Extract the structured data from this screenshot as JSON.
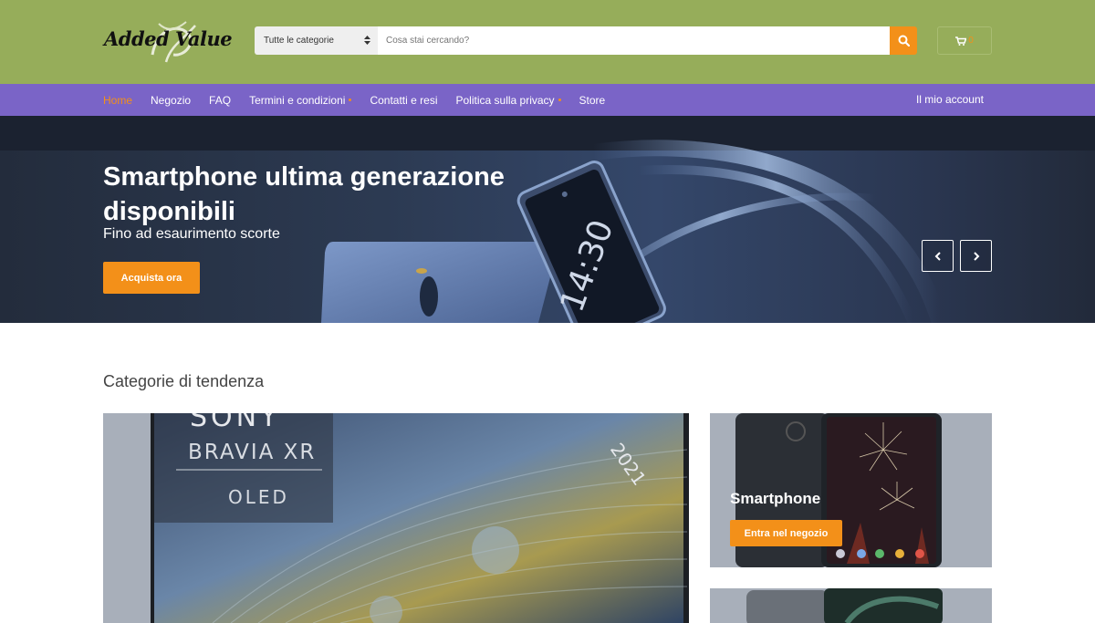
{
  "brand": {
    "logo_text": "Added Value"
  },
  "search": {
    "category": "Tutte le categorie",
    "placeholder": "Cosa stai cercando?"
  },
  "cart": {
    "count": "0"
  },
  "nav": {
    "items": [
      {
        "label": "Home",
        "active": true,
        "dropdown": false
      },
      {
        "label": "Negozio",
        "active": false,
        "dropdown": false
      },
      {
        "label": "FAQ",
        "active": false,
        "dropdown": false
      },
      {
        "label": "Termini e condizioni",
        "active": false,
        "dropdown": true
      },
      {
        "label": "Contatti e resi",
        "active": false,
        "dropdown": false
      },
      {
        "label": "Politica sulla privacy",
        "active": false,
        "dropdown": true
      },
      {
        "label": "Store",
        "active": false,
        "dropdown": false
      }
    ],
    "account": "Il mio account"
  },
  "hero": {
    "title": "Smartphone ultima generazione disponibili",
    "subtitle": "Fino ad esaurimento scorte",
    "button": "Acquista ora",
    "phone_time": "14:30"
  },
  "trending": {
    "title": "Categorie di tendenza",
    "tv_brand": "SONY",
    "tv_model": "BRAVIA XR",
    "tv_type": "OLED",
    "tv_year": "2021",
    "smartphone": {
      "title": "Smartphone",
      "button": "Entra nel negozio"
    }
  },
  "colors": {
    "header_bg": "#96ad5a",
    "nav_bg": "#7a64c7",
    "accent": "#f39019",
    "hero_bg": "#1b2230"
  }
}
